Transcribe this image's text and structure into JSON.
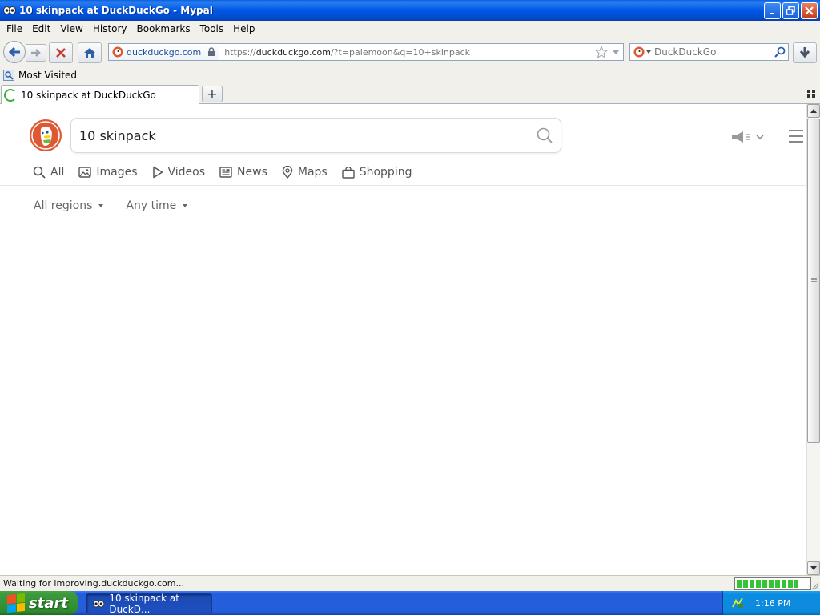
{
  "window": {
    "title": "10 skinpack at DuckDuckGo - Mypal"
  },
  "menu": {
    "items": [
      "File",
      "Edit",
      "View",
      "History",
      "Bookmarks",
      "Tools",
      "Help"
    ]
  },
  "navbar": {
    "identity_domain": "duckduckgo.com",
    "url_prefix": "https://",
    "url_host": "duckduckgo.com",
    "url_rest": "/?t=palemoon&q=10+skinpack",
    "search_engine_placeholder": "DuckDuckGo"
  },
  "bookmarks": {
    "items": [
      {
        "label": "Most Visited",
        "icon": "most-visited-icon"
      }
    ]
  },
  "tabs": {
    "items": [
      {
        "label": "10 skinpack at DuckDuckGo",
        "loading": true
      }
    ],
    "new_tab": "+"
  },
  "page": {
    "search_query": "10 skinpack",
    "nav_tabs": [
      {
        "label": "All",
        "icon": "search-icon"
      },
      {
        "label": "Images",
        "icon": "image-icon"
      },
      {
        "label": "Videos",
        "icon": "play-icon"
      },
      {
        "label": "News",
        "icon": "news-icon"
      },
      {
        "label": "Maps",
        "icon": "map-pin-icon"
      },
      {
        "label": "Shopping",
        "icon": "shopping-bag-icon"
      }
    ],
    "filters": [
      {
        "label": "All regions"
      },
      {
        "label": "Any time"
      }
    ],
    "accent": "#de5833"
  },
  "status": {
    "text": "Waiting for improving.duckduckgo.com...",
    "progress": 0.85
  },
  "taskbar": {
    "start_label": "start",
    "task_label": "10 skinpack at DuckD...",
    "clock": "1:16 PM"
  }
}
